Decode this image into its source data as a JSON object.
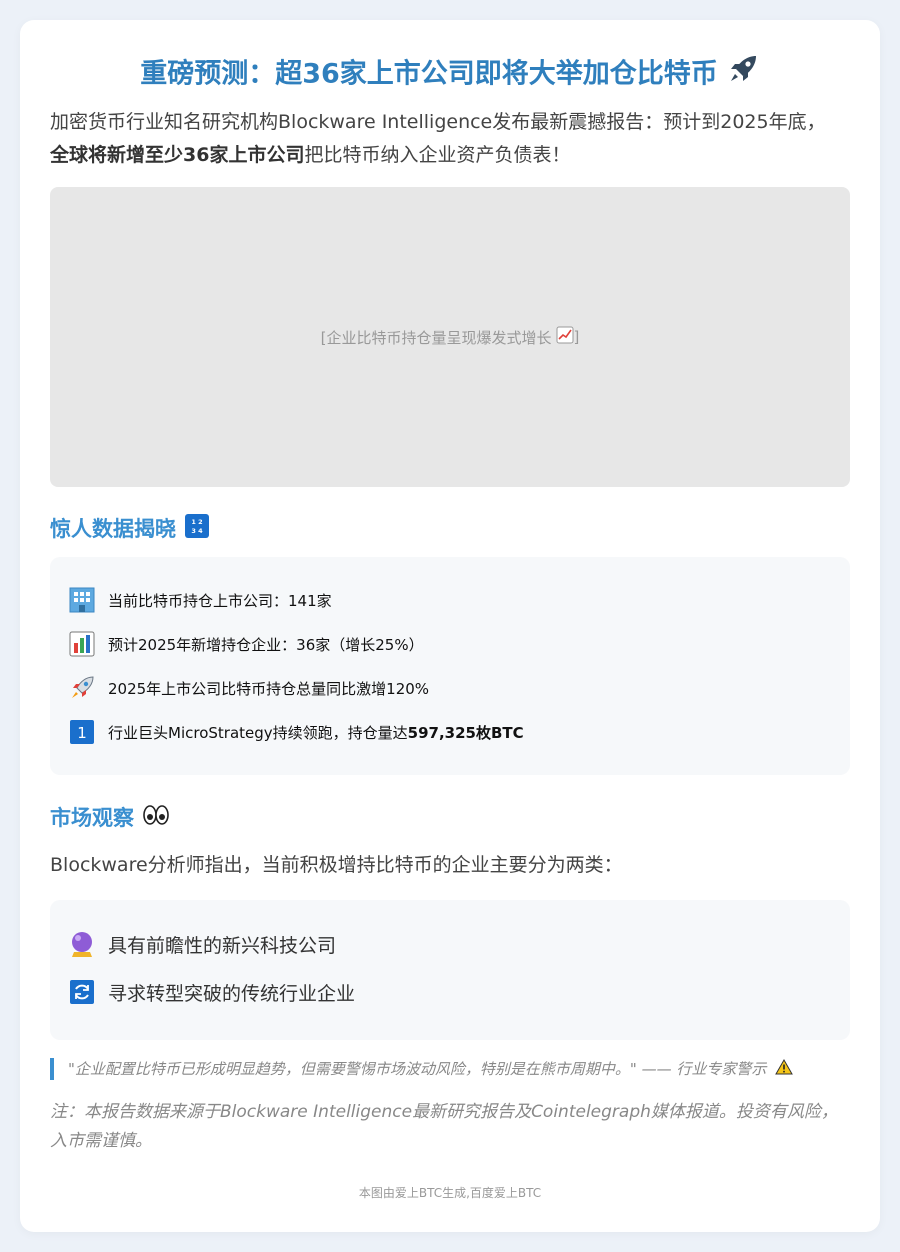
{
  "header": {
    "title": "重磅预测：超36家上市公司即将大举加仓比特币",
    "title_icon": "rocket-icon"
  },
  "intro": {
    "text_1": "加密货币行业知名研究机构Blockware Intelligence发布最新震撼报告：预计到2025年底，",
    "text_bold": "全球将新增至少36家上市公司",
    "text_2": "把比特币纳入企业资产负债表！"
  },
  "image_placeholder": {
    "text": "[企业比特币持仓量呈现爆发式增长",
    "close": "]",
    "icon": "chart-increasing-icon"
  },
  "stats_section": {
    "heading": "惊人数据揭晓",
    "heading_icon": "numbers-icon",
    "items": [
      {
        "icon": "office-building-icon",
        "text": "当前比特币持仓上市公司：141家"
      },
      {
        "icon": "bar-chart-icon",
        "text": "预计2025年新增持仓企业：36家（增长25%）"
      },
      {
        "icon": "rocket-icon",
        "text": "2025年上市公司比特币持仓总量同比激增120%"
      },
      {
        "icon": "keycap-one-icon",
        "text": "行业巨头MicroStrategy持续领跑，持仓量达",
        "bold": "597,325枚BTC"
      }
    ]
  },
  "market_section": {
    "heading": "市场观察",
    "heading_icon": "eyes-icon",
    "text": "Blockware分析师指出，当前积极增持比特币的企业主要分为两类：",
    "items": [
      {
        "icon": "crystal-ball-icon",
        "text": "具有前瞻性的新兴科技公司"
      },
      {
        "icon": "refresh-icon",
        "text": "寻求转型突破的传统行业企业"
      }
    ]
  },
  "quote": {
    "text": "\"企业配置比特币已形成明显趋势，但需要警惕市场波动风险，特别是在熊市周期中。\" —— 行业专家警示",
    "icon": "warning-icon"
  },
  "note": {
    "text": "注：本报告数据来源于Blockware Intelligence最新研究报告及Cointelegraph媒体报道。投资有风险，入市需谨慎。"
  },
  "footer": {
    "text": "本图由爱上BTC生成,百度爱上BTC"
  },
  "colors": {
    "accent": "#3a8fd0",
    "title": "#2f7fbd",
    "background": "#ecf1f8"
  }
}
